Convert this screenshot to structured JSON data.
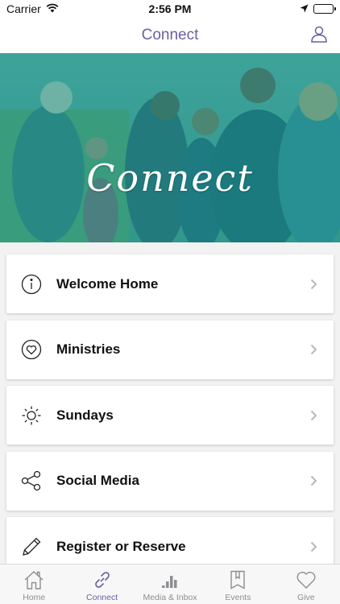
{
  "status_bar": {
    "carrier": "Carrier",
    "time": "2:56 PM"
  },
  "nav": {
    "title": "Connect",
    "profile_icon": "person-icon"
  },
  "hero": {
    "title": "Connect",
    "tint_color": "#1e9c95"
  },
  "menu": {
    "items": [
      {
        "label": "Welcome Home",
        "icon": "info-icon"
      },
      {
        "label": "Ministries",
        "icon": "heart-icon"
      },
      {
        "label": "Sundays",
        "icon": "sun-icon"
      },
      {
        "label": "Social Media",
        "icon": "share-icon"
      },
      {
        "label": "Register or Reserve",
        "icon": "pencil-icon"
      }
    ]
  },
  "tabs": [
    {
      "label": "Home",
      "icon": "home-icon",
      "active": false
    },
    {
      "label": "Connect",
      "icon": "link-icon",
      "active": true
    },
    {
      "label": "Media & Inbox",
      "icon": "equalizer-icon",
      "active": false
    },
    {
      "label": "Events",
      "icon": "bookmark-icon",
      "active": false
    },
    {
      "label": "Give",
      "icon": "heart-icon",
      "active": false
    }
  ],
  "colors": {
    "accent": "#6b5fa0",
    "inactive": "#8e8e93"
  }
}
